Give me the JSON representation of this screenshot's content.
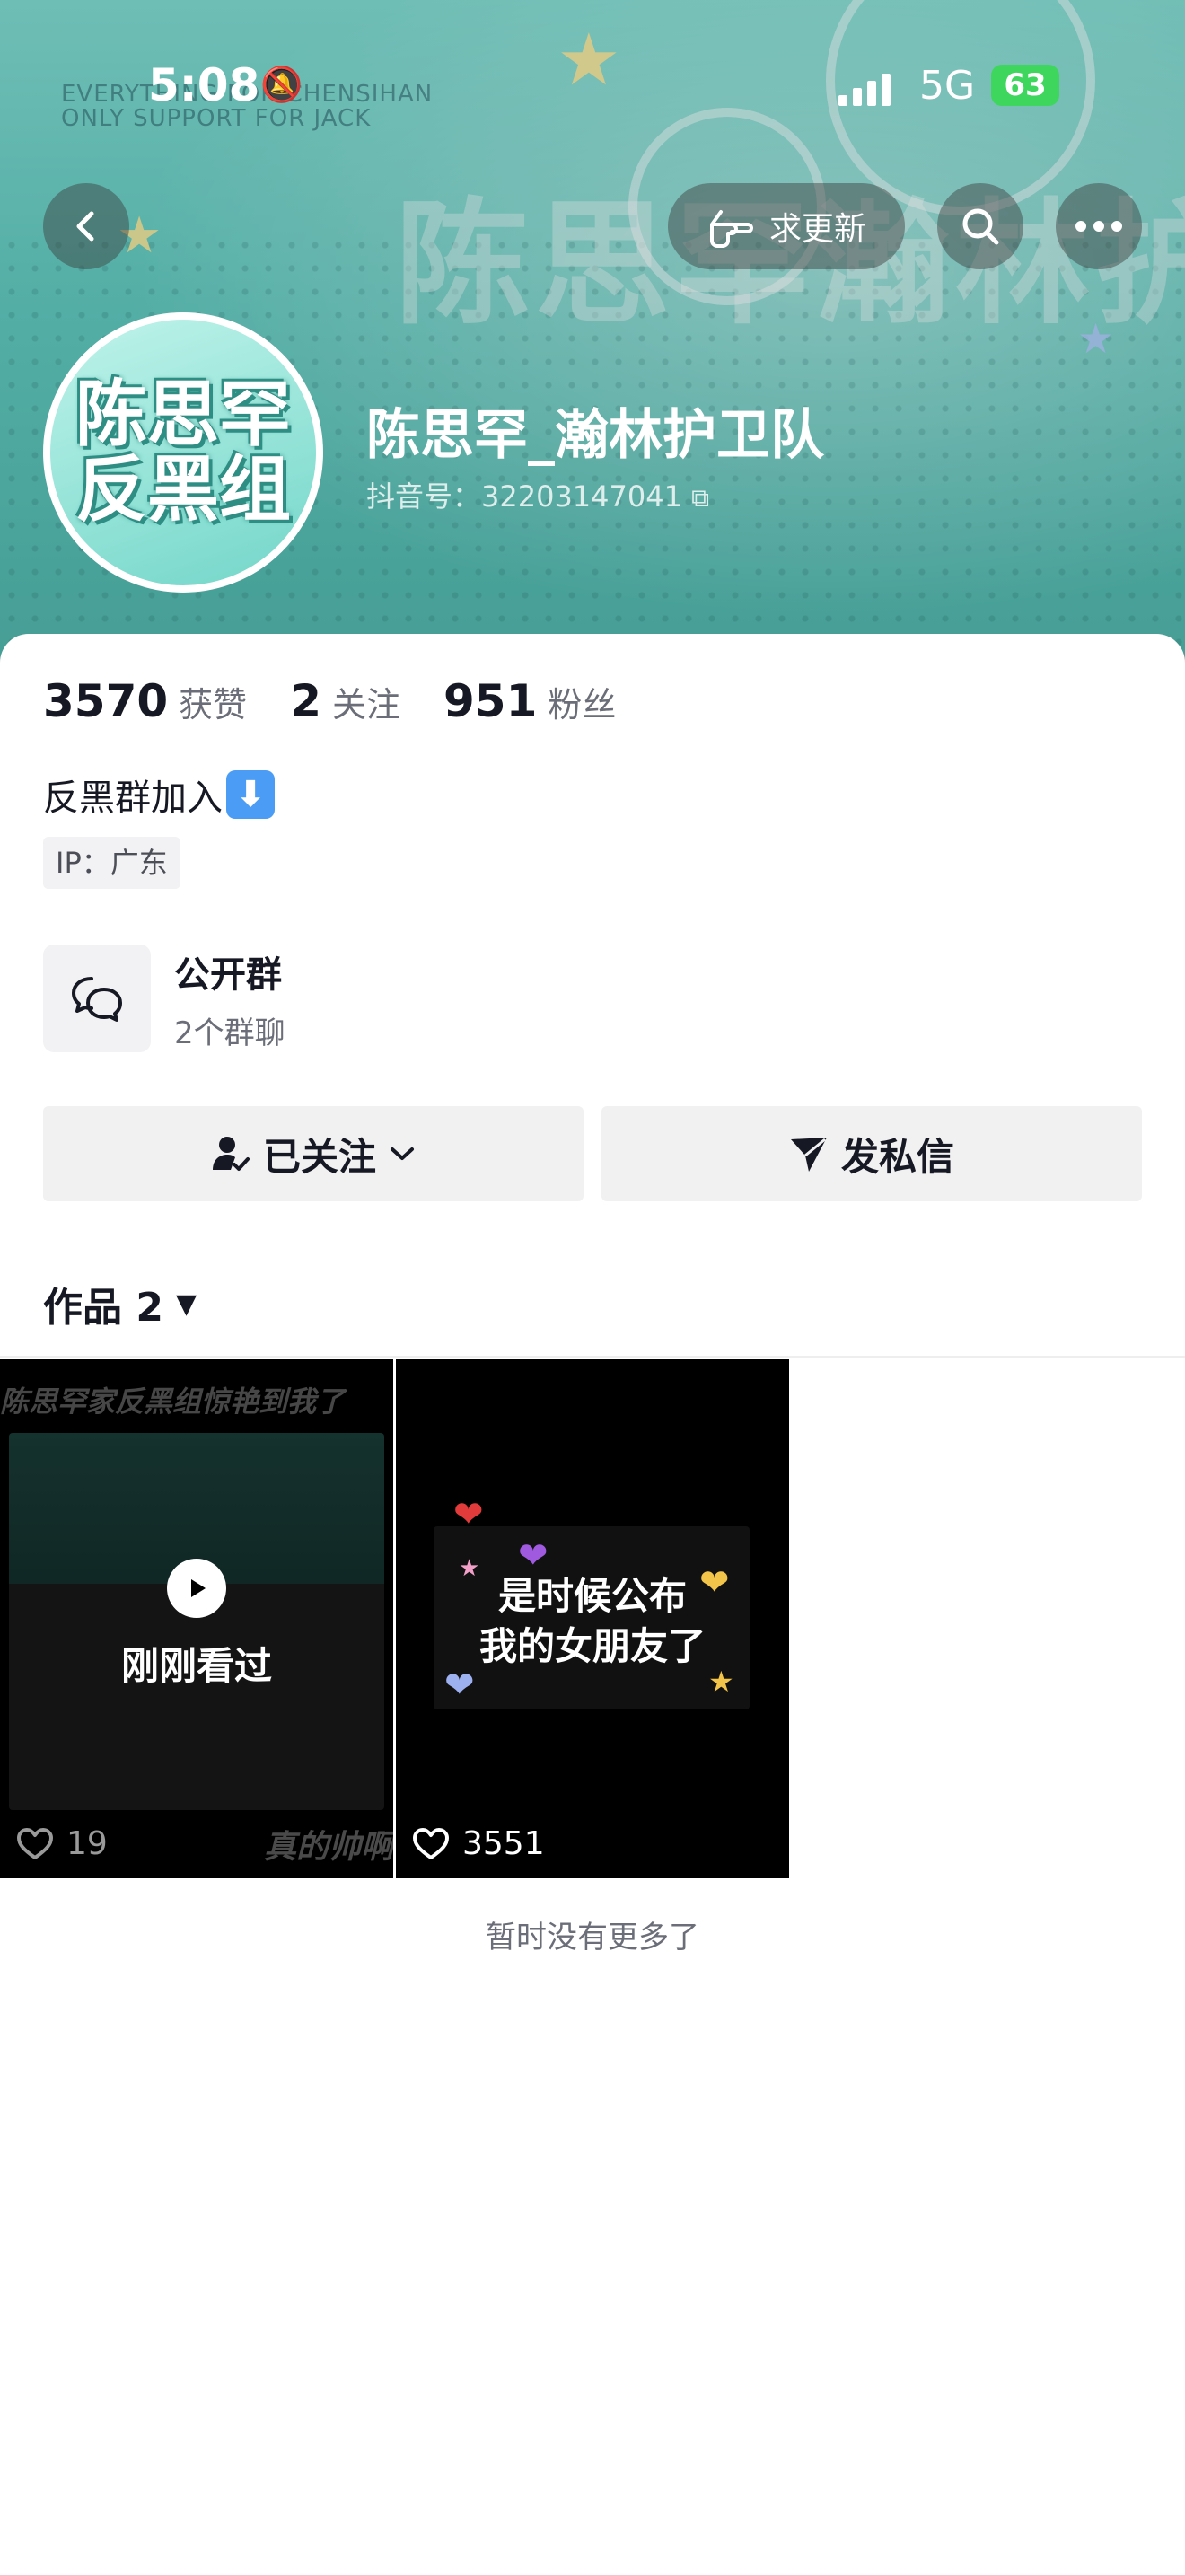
{
  "status_bar": {
    "time": "5:08",
    "network": "5G",
    "battery": "63"
  },
  "header": {
    "back_icon": "chevron-left-icon",
    "request_update_label": "求更新",
    "search_icon": "search-icon",
    "more_icon": "more-icon",
    "banner_text": "陈思罕瀚林护卫队",
    "banner_small_text_1": "EVERYTHING FOR CHENSIHAN",
    "banner_small_text_2": "ONLY SUPPORT FOR JACK"
  },
  "profile": {
    "avatar_line1": "陈思罕",
    "avatar_line2": "反黑组",
    "name": "陈思罕_瀚林护卫队",
    "douyin_id": "抖音号：32203147041"
  },
  "stats": [
    {
      "value": "3570",
      "label": "获赞"
    },
    {
      "value": "2",
      "label": "关注"
    },
    {
      "value": "951",
      "label": "粉丝"
    }
  ],
  "bio": {
    "text": "反黑群加入",
    "emoji": "⬇"
  },
  "ip_tag": "IP：广东",
  "group": {
    "title": "公开群",
    "subtitle": "2个群聊"
  },
  "actions": {
    "following_label": "已关注",
    "message_label": "发私信"
  },
  "works_tab": {
    "label": "作品 2"
  },
  "videos": [
    {
      "caption": "陈思罕家反黑组惊艳到我了",
      "overlay": "刚刚看过",
      "bottom_text": "真的帅啊",
      "likes": "19"
    },
    {
      "line1": "是时候公布",
      "line2": "我的女朋友了",
      "likes": "3551"
    }
  ],
  "footer_note": "暂时没有更多了",
  "colors": {
    "banner": "#5fc7bd",
    "battery": "#3fd65e",
    "button_bg": "#f1f1f2"
  }
}
